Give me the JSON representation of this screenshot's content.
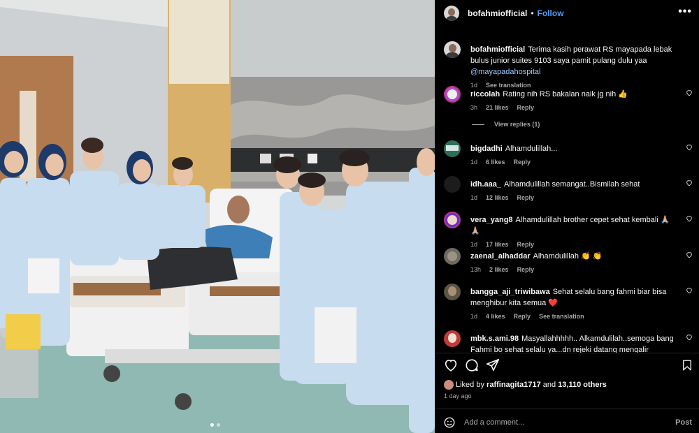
{
  "post": {
    "username": "bofahmiofficial",
    "separator": "•",
    "follow_label": "Follow",
    "more_icon": "more-horizontal-icon",
    "caption": {
      "username": "bofahmiofficial",
      "text": "Terima kasih perawat RS mayapada lebak bulus junior suites 9103 saya pamit pulang dulu yaa",
      "mention": "@mayapadahospital",
      "time": "1d",
      "see_translation": "See translation"
    }
  },
  "comments": [
    {
      "username": "riccolah",
      "text": "Rating nih RS bakalan naik jg nih 👍",
      "time": "3h",
      "likes": "21 likes",
      "reply": "Reply"
    },
    {
      "username": "bigdadhi",
      "text": "Alhamdulillah...",
      "time": "1d",
      "likes": "6 likes",
      "reply": "Reply"
    },
    {
      "username": "idh.aaa_",
      "text": "Alhamdulillah semangat..Bismilah sehat",
      "time": "1d",
      "likes": "12 likes",
      "reply": "Reply"
    },
    {
      "username": "vera_yang8",
      "text": "Alhamdulillah brother cepet sehat kembali 🙏🏼 🙏🏼",
      "time": "1d",
      "likes": "17 likes",
      "reply": "Reply"
    },
    {
      "username": "zaenal_alhaddar",
      "text": "Alhamdulillah 👏 👏",
      "time": "13h",
      "likes": "2 likes",
      "reply": "Reply"
    },
    {
      "username": "bangga_aji_triwibawa",
      "text": "Sehat selalu bang fahmi biar bisa menghibur kita semua ❤️",
      "time": "1d",
      "likes": "4 likes",
      "reply": "Reply",
      "see_translation": "See translation"
    },
    {
      "username": "mbk.s.ami.98",
      "text": "Masyallahhhhh.. Alkamdulilah..semoga bang Fahmi bo sehat selalu ya...dn rejeki datang mengalir terus..jngn",
      "time": "",
      "likes": "",
      "reply": ""
    }
  ],
  "view_replies": "View replies (1)",
  "likes": {
    "prefix": "Liked by",
    "user": "raffinagita1717",
    "and": "and",
    "others": "13,110 others"
  },
  "posted_ago": "1 day ago",
  "add_comment": {
    "placeholder": "Add a comment...",
    "post_label": "Post"
  },
  "icons": {
    "like": "heart-icon",
    "comment": "comment-icon",
    "share": "share-icon",
    "save": "bookmark-icon",
    "emoji": "emoji-icon"
  },
  "colors": {
    "background": "#000000",
    "link_blue": "#4d9cf7",
    "muted": "#a8a8a8"
  },
  "carousel": {
    "count": 2,
    "active": 1
  }
}
